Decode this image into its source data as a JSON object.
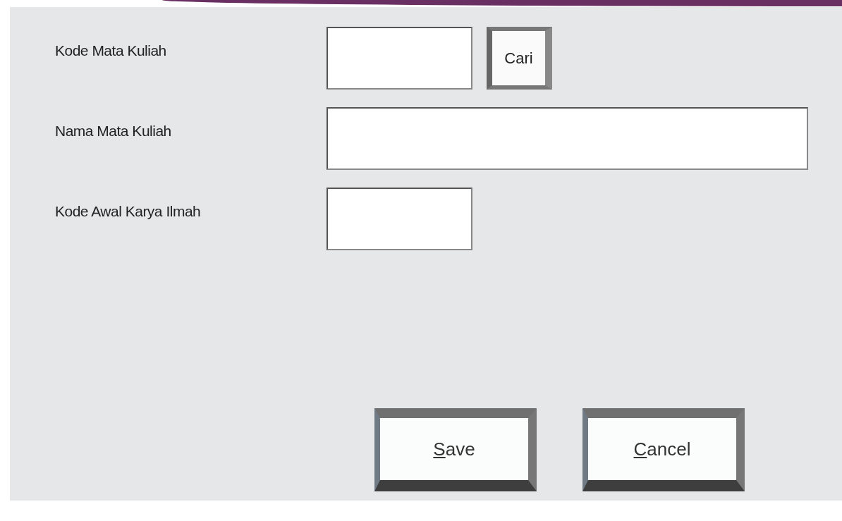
{
  "fields": [
    {
      "label": "Kode Mata Kuliah",
      "kind": "short",
      "button": {
        "label": "Cari"
      }
    },
    {
      "label": "Nama Mata Kuliah",
      "kind": "long"
    },
    {
      "label": "Kode Awal Karya Ilmah",
      "kind": "short"
    }
  ],
  "buttons": [
    {
      "accel": "S",
      "rest": "ave"
    },
    {
      "accel": "C",
      "rest": "ancel"
    }
  ]
}
